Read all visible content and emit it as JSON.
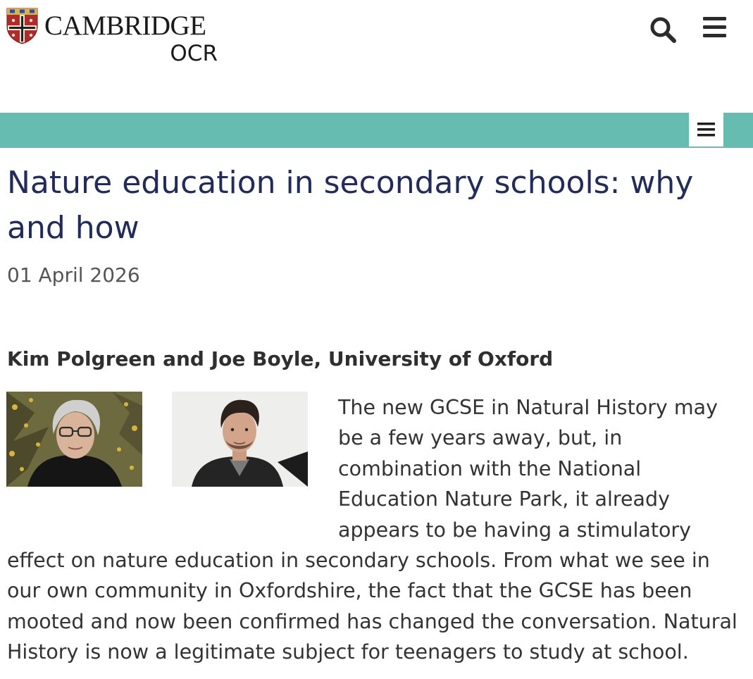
{
  "header": {
    "logo_top": "CAMBRIDGE",
    "logo_bottom": "OCR",
    "logo_icon": "cambridge-crest-icon",
    "search_icon": "search-icon",
    "menu_icon": "hamburger-menu-icon"
  },
  "nav": {
    "toggle_icon": "hamburger-menu-icon"
  },
  "article": {
    "title": "Nature education in secondary schools: why and how",
    "date": "01 April 2026",
    "author": "Kim Polgreen and Joe Boyle, University of Oxford",
    "body": "The new GCSE in Natural History may be a few years away, but, in combination with the National Education Nature Park, it already appears to be having a stimulatory effect on nature education in secondary schools. From what we see in our own community in Oxfordshire, the fact that the GCSE has been mooted and now been confirmed has changed the conversation. Natural History is now a legitimate subject for teenagers to study at school."
  },
  "colors": {
    "nav_bar": "#67bcb2",
    "title": "#232b5a",
    "body_text": "#333333",
    "date_text": "#555555"
  }
}
